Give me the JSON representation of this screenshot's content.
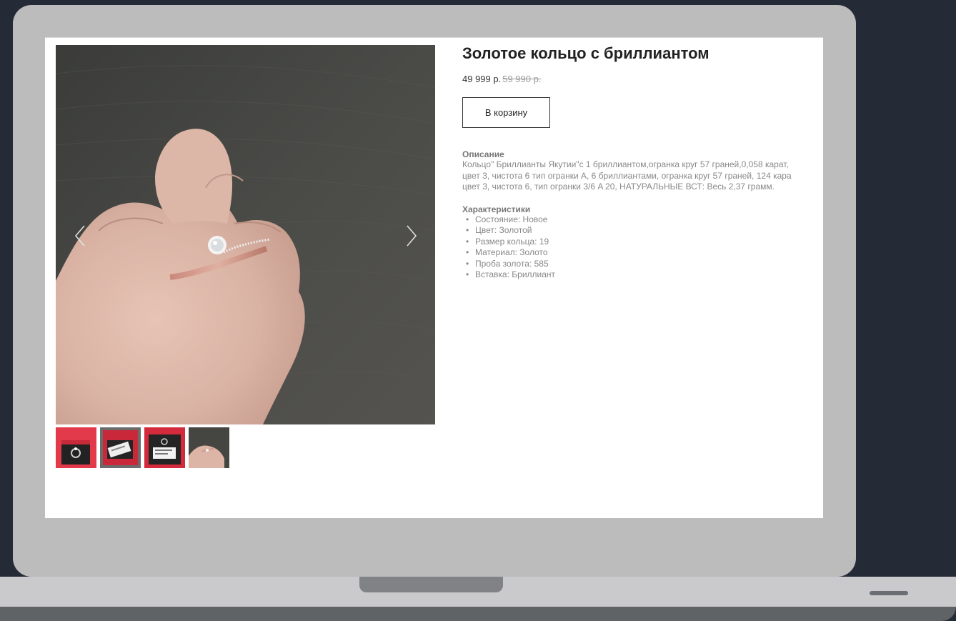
{
  "product": {
    "title": "Золотое кольцо с бриллиантом",
    "price": "49 999 р.",
    "old_price": "59 990 р.",
    "cart_button_label": "В корзину"
  },
  "description": {
    "heading": "Описание",
    "lines": [
      "Кольцо\" Бриллианты Якутии\"с 1 бриллиантом,огранка круг 57 граней,0,058 карат,",
      "цвет 3, чистота 6 тип огранки A, 6 бриллиантами, огранка круг 57 граней, 124 кара",
      "цвет 3, чистота 6, тип огранки 3/6 A 20, НАТУРАЛЬНЫЕ ВСТ: Весь 2,37 грамм."
    ]
  },
  "specs": {
    "heading": "Характеристики",
    "items": [
      "Состояние: Новое",
      "Цвет: Золотой",
      "Размер кольца: 19",
      "Материал: Золото",
      "Проба золота: 585",
      "Вставка: Бриллиант"
    ]
  },
  "gallery": {
    "main_image": "hand-with-diamond-ring-photo",
    "thumbnails": [
      "ring-in-red-box-photo",
      "ring-box-with-tag-photo",
      "ring-box-with-certificate-photo",
      "hand-with-ring-photo"
    ],
    "prev_icon": "chevron-left-icon",
    "next_icon": "chevron-right-icon"
  }
}
